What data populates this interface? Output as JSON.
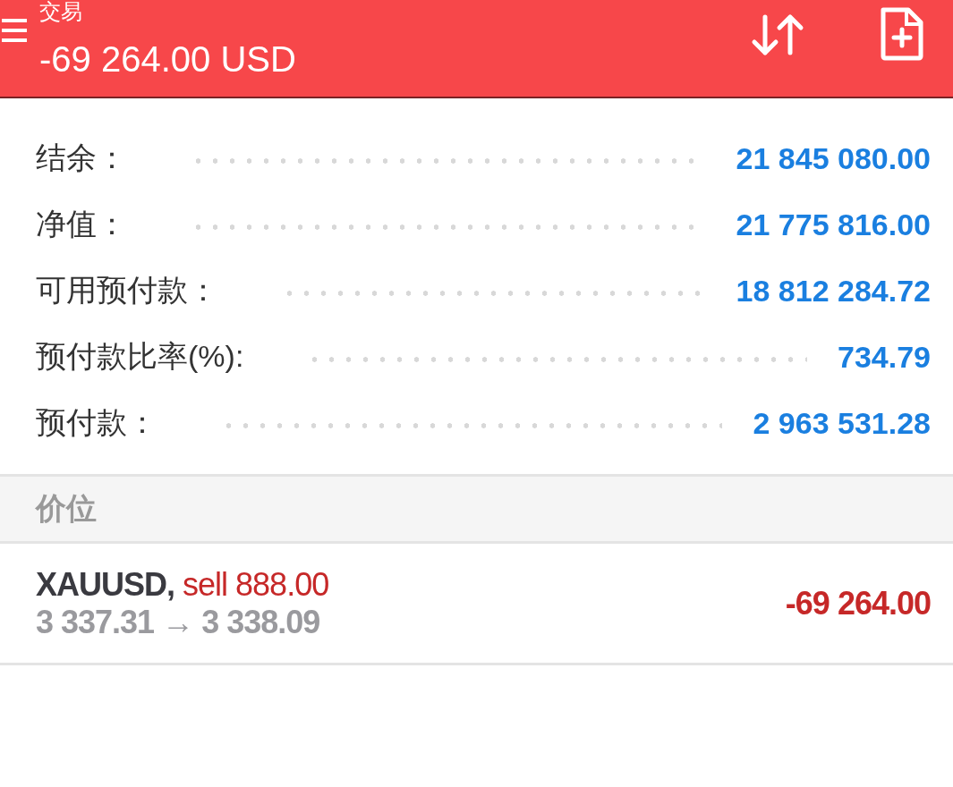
{
  "header": {
    "title": "交易",
    "amount": "-69 264.00 USD"
  },
  "summary": [
    {
      "label": "结余：",
      "value": "21 845 080.00"
    },
    {
      "label": "净值：",
      "value": "21 775 816.00"
    },
    {
      "label": "可用预付款：",
      "value": "18 812 284.72"
    },
    {
      "label": "预付款比率(%):",
      "value": "734.79"
    },
    {
      "label": "预付款：",
      "value": "2 963 531.28"
    }
  ],
  "section": {
    "title": "价位"
  },
  "positions": [
    {
      "symbol": "XAUUSD,",
      "side": "sell 888.00",
      "prices": "3 337.31 → 3 338.09",
      "profit": "-69 264.00"
    }
  ]
}
